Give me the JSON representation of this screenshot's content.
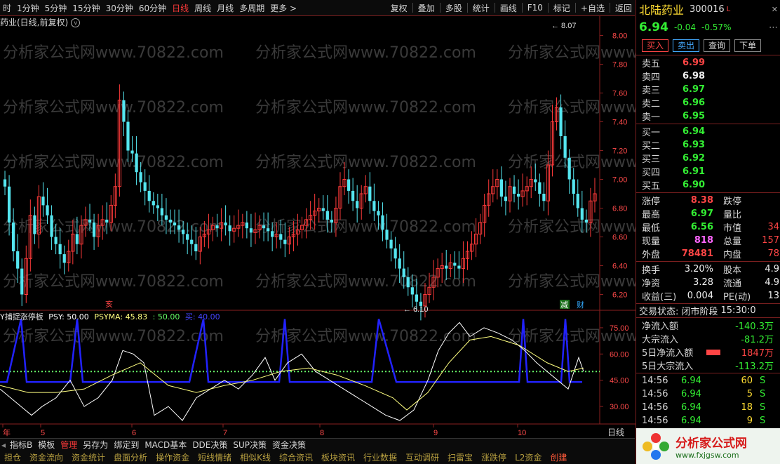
{
  "toolbar": {
    "left": [
      "时",
      "1分钟",
      "5分钟",
      "15分钟",
      "30分钟",
      "60分钟",
      "日线",
      "周线",
      "月线",
      "多周期",
      "更多 >"
    ],
    "active_index": 6,
    "right": [
      "复权",
      "叠加",
      "多股",
      "统计",
      "画线",
      "F10",
      "标记",
      "+自选",
      "返回"
    ]
  },
  "chart_title": {
    "text": "药业(日线,前复权)",
    "icon": "chevron-down-icon",
    "icon_glyph": "v"
  },
  "price_chart": {
    "y_ticks": [
      "8.00",
      "7.80",
      "7.60",
      "7.40",
      "7.20",
      "7.00",
      "6.80",
      "6.60",
      "6.40",
      "6.20"
    ],
    "high_label": "8.07",
    "low_label": "6.10",
    "markers": {
      "left": "亥",
      "jian": "减",
      "cai": "财"
    }
  },
  "indicator": {
    "name": "PSY捕捉涨停板",
    "name_prefix": "Y捕捉涨停板",
    "psy": "PSY: 50.00",
    "psyma": "PSYMA: 45.83",
    "level1": ": 50.00",
    "level2": "买: 40.00",
    "y_ticks": [
      "75.00",
      "60.00",
      "45.00",
      "30.00"
    ]
  },
  "x_axis": {
    "labels": [
      "年",
      "5",
      "6",
      "7",
      "8",
      "9",
      "10"
    ],
    "right_label": "日线"
  },
  "bottom_tabs": {
    "items": [
      "指标B",
      "模板",
      "管理",
      "另存为",
      "绑定到",
      "MACD基本",
      "DDE决策",
      "SUP决策",
      "资金决策"
    ],
    "active_index": 2
  },
  "bottom_row2": {
    "items": [
      "担仓",
      "资金流向",
      "资金统计",
      "盘面分析",
      "操作资金",
      "短线情绪",
      "相似K线",
      "综合资讯",
      "板块资讯",
      "行业数据",
      "互动调研",
      "扫雷宝",
      "涨跌停",
      "L2资金",
      "创建"
    ],
    "active_index": 14
  },
  "watermark": {
    "text": "分析家公式网www.70822.com",
    "rows": [
      {
        "top": 60,
        "x": [
          0,
          360,
          720
        ]
      },
      {
        "top": 138,
        "x": [
          0,
          360,
          720
        ]
      },
      {
        "top": 216,
        "x": [
          0,
          360,
          720
        ]
      },
      {
        "top": 308,
        "x": [
          0,
          360,
          720
        ]
      },
      {
        "top": 386,
        "x": [
          0,
          360,
          720
        ]
      },
      {
        "top": 464,
        "x": [
          0,
          360,
          720
        ]
      }
    ]
  },
  "stock": {
    "name": "北陆药业",
    "code": "300016",
    "code_suffix": "L",
    "price": "6.94",
    "change": "-0.04",
    "pct": "-0.57%"
  },
  "actions": {
    "buy": "买入",
    "sell": "卖出",
    "query": "查询",
    "trade": "下单"
  },
  "asks": [
    {
      "label": "卖五",
      "price": "6.99"
    },
    {
      "label": "卖四",
      "price": "6.98"
    },
    {
      "label": "卖三",
      "price": "6.97"
    },
    {
      "label": "卖二",
      "price": "6.96"
    },
    {
      "label": "卖一",
      "price": "6.95"
    }
  ],
  "bids": [
    {
      "label": "买一",
      "price": "6.94"
    },
    {
      "label": "买二",
      "price": "6.93"
    },
    {
      "label": "买三",
      "price": "6.92"
    },
    {
      "label": "买四",
      "price": "6.91"
    },
    {
      "label": "买五",
      "price": "6.90"
    }
  ],
  "stats1": [
    {
      "l1": "涨停",
      "v1": "8.38",
      "c1": "red",
      "l2": "跌停",
      "v2": ""
    },
    {
      "l1": "最高",
      "v1": "6.97",
      "c1": "green",
      "l2": "量比",
      "v2": ""
    },
    {
      "l1": "最低",
      "v1": "6.56",
      "c1": "green",
      "l2": "市值",
      "v2": "34"
    },
    {
      "l1": "现量",
      "v1": "818",
      "c1": "pink",
      "l2": "总量",
      "v2": "157"
    },
    {
      "l1": "外盘",
      "v1": "78481",
      "c1": "red",
      "l2": "内盘",
      "v2": "78"
    }
  ],
  "stats2": [
    {
      "l1": "换手",
      "v1": "3.20%",
      "l2": "股本",
      "v2": "4.9"
    },
    {
      "l1": "净资",
      "v1": "3.28",
      "l2": "流通",
      "v2": "4.9"
    },
    {
      "l1": "收益(三)",
      "v1": "0.004",
      "l2": "PE(动)",
      "v2": "13"
    }
  ],
  "trade_status": {
    "label": "交易状态: 闭市阶段",
    "time": "15:30:0"
  },
  "flows": [
    {
      "label": "净流入额",
      "value": "-140.3万"
    },
    {
      "label": "大宗流入",
      "value": "-81.2万"
    },
    {
      "label": "5日净流入额",
      "value": "1847万"
    },
    {
      "label": "5日大宗流入",
      "value": "-113.2万"
    }
  ],
  "ticks": [
    {
      "time": "14:56",
      "price": "6.94",
      "vol": "60",
      "side": "S"
    },
    {
      "time": "14:56",
      "price": "6.94",
      "vol": "5",
      "side": "S"
    },
    {
      "time": "14:56",
      "price": "6.94",
      "vol": "18",
      "side": "S"
    },
    {
      "time": "14:56",
      "price": "6.94",
      "vol": "9",
      "side": "S"
    }
  ],
  "logo": {
    "text": "分析家公式网",
    "url": "www.fxjgsw.com"
  },
  "colors": {
    "up": "#ff3a3a",
    "down": "#55e6f0",
    "psy": "#ffffff",
    "psyma": "#ffff80",
    "signal": "#2222ff",
    "level": "#66ff66"
  }
}
